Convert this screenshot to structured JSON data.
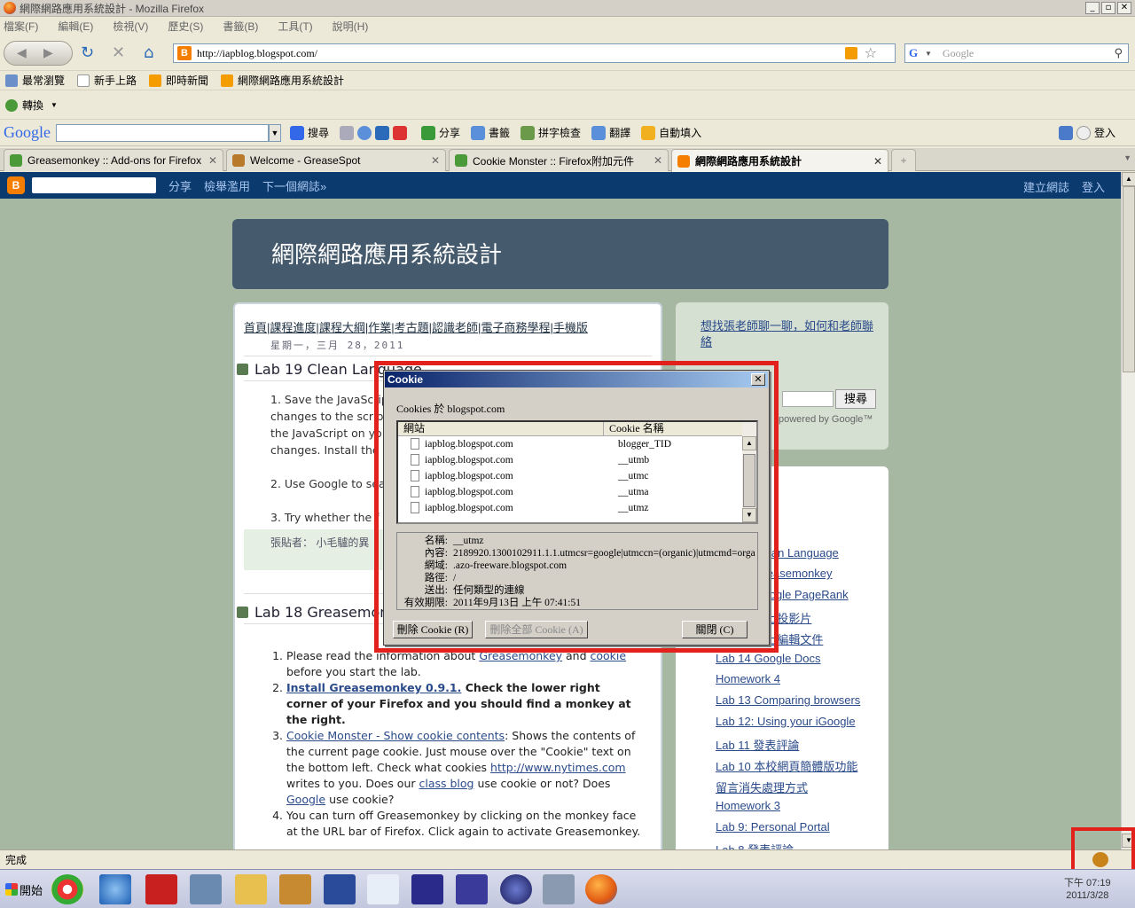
{
  "window": {
    "title": "網際網路應用系統設計 - Mozilla Firefox",
    "controls": [
      "_",
      "▫",
      "✕"
    ]
  },
  "menu": [
    "檔案(F)",
    "編輯(E)",
    "檢視(V)",
    "歷史(S)",
    "書籤(B)",
    "工具(T)",
    "說明(H)"
  ],
  "nav": {
    "url": "http://iapblog.blogspot.com/",
    "search_placeholder": "Google",
    "search_engine": "G"
  },
  "bookmarks": [
    "最常瀏覽",
    "新手上路",
    "即時新聞",
    "網際網路應用系統設計"
  ],
  "convert": "轉換",
  "google_toolbar": {
    "logo": "Google",
    "items": [
      "搜尋",
      "分享",
      "書籤",
      "拼字檢查",
      "翻譯",
      "自動填入",
      "登入"
    ]
  },
  "tabs": [
    {
      "label": "Greasemonkey :: Add-ons for Firefox",
      "color": "#4a9a3a"
    },
    {
      "label": "Welcome - GreaseSpot",
      "color": "#b87a2a"
    },
    {
      "label": "Cookie Monster :: Firefox附加元件",
      "color": "#4a9a3a"
    },
    {
      "label": "網際網路應用系統設計",
      "color": "#f57d00",
      "active": true
    }
  ],
  "blogger_bar": {
    "logo": "B",
    "links": [
      "分享",
      "檢舉濫用",
      "下一個網誌»"
    ],
    "right": [
      "建立網誌",
      "登入"
    ]
  },
  "blog": {
    "title": "網際網路應用系統設計",
    "navlinks": [
      "首頁",
      "課程進度",
      "課程大綱",
      "作業",
      "考古題",
      "認識老師",
      "電子商務學程",
      "手機版"
    ],
    "date": "星期一，三月 28，2011",
    "post1_title": "Lab 19 Clean Language",
    "post1_lines": [
      "1. Save the JavaScrip",
      "changes to the scrip",
      "the JavaScript on yo",
      "changes. Install the",
      "2. Use Google to sea",
      "3. Try whether the f"
    ],
    "post1_author": "張貼者： 小毛驢的異",
    "post2_title": "Lab 18 Greasemonkey",
    "post2_items": [
      "Please read the information about Greasemonkey and cookie before you start the lab.",
      "Install Greasemonkey 0.9.1. Check the lower right corner of your Firefox and you should find a monkey at the right.",
      "Cookie Monster - Show cookie contents: Shows the contents of the current page cookie. Just mouse over the \"Cookie\" text on the bottom left. Check what cookies http://www.nytimes.com writes to you. Does our class blog use cookie or not? Does Google use cookie?",
      "You can turn off Greasemonkey by clicking on the monkey face at the URL bar of Firefox. Click again to activate Greasemonkey."
    ],
    "side_link": "想找張老師聊一聊，如何和老師聯絡",
    "side_search_btn": "搜尋",
    "powered": "powered by Google™",
    "side_list": [
      "Lab 19 Clean Language",
      "Lab 18 Greasemonkey",
      "Lab 17 Google PageRank",
      "Lab 16 線上投影片",
      "Lab 15 線上編輯文件",
      "Lab 14 Google Docs",
      "Homework 4",
      "Lab 13 Comparing browsers",
      "Lab 12: Using your iGoogle",
      "Lab 11 發表評論",
      "Lab 10 本校網頁簡體版功能",
      "留言消失處理方式",
      "Homework 3",
      "Lab 9: Personal Portal",
      "Lab 8 發表評論"
    ]
  },
  "dialog": {
    "title": "Cookie",
    "subtitle": "Cookies 於 blogspot.com",
    "col_site": "網站",
    "col_name": "Cookie 名稱",
    "rows": [
      {
        "site": "iapblog.blogspot.com",
        "name": "blogger_TID"
      },
      {
        "site": "iapblog.blogspot.com",
        "name": "__utmb"
      },
      {
        "site": "iapblog.blogspot.com",
        "name": "__utmc"
      },
      {
        "site": "iapblog.blogspot.com",
        "name": "__utma"
      },
      {
        "site": "iapblog.blogspot.com",
        "name": "__utmz"
      }
    ],
    "details": [
      {
        "k": "名稱:",
        "v": "__utmz"
      },
      {
        "k": "內容:",
        "v": "2189920.1300102911.1.1.utmcsr=google|utmccn=(organic)|utmcmd=orga"
      },
      {
        "k": "網域:",
        "v": ".azo-freeware.blogspot.com"
      },
      {
        "k": "路徑:",
        "v": "/"
      },
      {
        "k": "送出:",
        "v": "任何類型的連線"
      },
      {
        "k": "有效期限:",
        "v": "2011年9月13日 上午 07:41:51"
      }
    ],
    "btn_delete": "刪除 Cookie (R)",
    "btn_delete_all": "刪除全部 Cookie (A)",
    "btn_close": "關閉 (C)"
  },
  "status": "完成",
  "taskbar": {
    "start": "開始",
    "time": "下午 07:19",
    "date": "2011/3/28"
  }
}
